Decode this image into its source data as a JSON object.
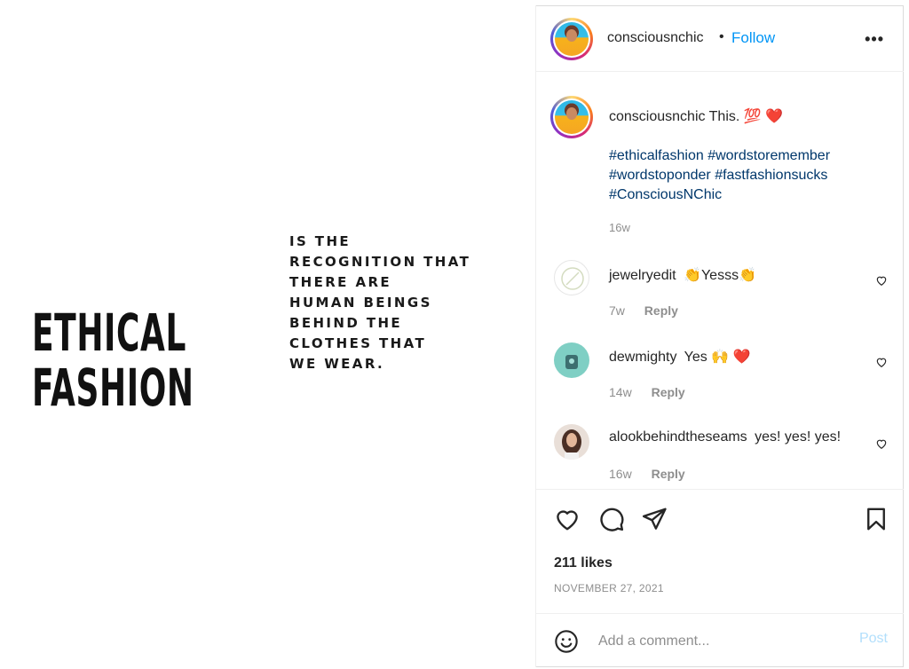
{
  "post_image": {
    "title_lines": [
      "ETHICAL",
      "FASHION"
    ],
    "quote_lines": [
      "IS THE",
      "RECOGNITION THAT",
      "THERE ARE",
      "HUMAN BEINGS",
      "BEHIND THE",
      "CLOTHES THAT",
      "WE WEAR."
    ]
  },
  "header": {
    "username": "consciousnchic",
    "separator": "•",
    "follow_label": "Follow",
    "more_label": "•••"
  },
  "caption": {
    "username": "consciousnchic",
    "text": "This. 💯 ❤️",
    "hashtags": "#ethicalfashion #wordstoremember #wordstoponder #fastfashionsucks #ConsciousNChic",
    "time": "16w"
  },
  "comments": [
    {
      "username": "jewelryedit",
      "text": "👏Yesss👏",
      "time": "7w",
      "reply": "Reply"
    },
    {
      "username": "dewmighty",
      "text": "Yes 🙌 ❤️",
      "time": "14w",
      "reply": "Reply"
    },
    {
      "username": "alookbehindtheseams",
      "text": "yes! yes! yes!",
      "time": "16w",
      "reply": "Reply"
    }
  ],
  "actions": {
    "likes": "211 likes",
    "date": "NOVEMBER 27, 2021"
  },
  "add_comment": {
    "placeholder": "Add a comment...",
    "post_label": "Post"
  },
  "icons": {
    "like": "heart-icon",
    "comment": "comment-bubble-icon",
    "share": "paper-plane-icon",
    "save": "bookmark-icon",
    "emoji": "smiley-icon",
    "more": "more-options-icon"
  },
  "colors": {
    "link_blue": "#0095f6",
    "hashtag": "#00376b",
    "muted": "#8e8e8e",
    "post_disabled": "#b2dffc",
    "heart_red": "#ed4956"
  }
}
